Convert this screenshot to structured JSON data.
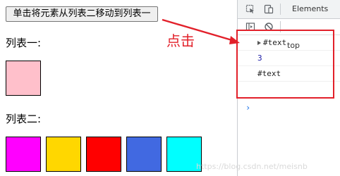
{
  "page": {
    "move_button_label": "单击将元素从列表二移动到列表一",
    "list_one_title": "列表一:",
    "list_two_title": "列表二:",
    "list_one_boxes": [
      {
        "color": "#ffc0cb"
      }
    ],
    "list_two_boxes": [
      {
        "color": "#ff00ff"
      },
      {
        "color": "#ffd700"
      },
      {
        "color": "#ff0000"
      },
      {
        "color": "#4169e1"
      },
      {
        "color": "#00ffff"
      }
    ]
  },
  "annotation": {
    "label": "点击",
    "color": "#e2202a"
  },
  "devtools": {
    "elements_tab": "Elements",
    "context": "top",
    "icons": [
      "cursor-select-icon",
      "device-toggle-icon",
      "sidebar-icon",
      "clear-console-icon"
    ],
    "console_lines": [
      {
        "text": "#text",
        "expandable": true
      },
      {
        "text": "3",
        "expandable": false
      },
      {
        "text": "#text",
        "expandable": false
      }
    ],
    "prompt_symbol": "›"
  },
  "watermark": "https://blog.csdn.net/meisnb"
}
